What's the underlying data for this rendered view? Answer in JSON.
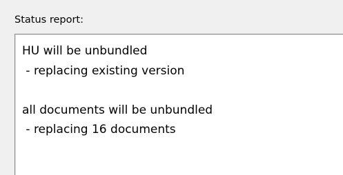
{
  "status_report": {
    "label": "Status report:",
    "lines": [
      "HU will be unbundled",
      " - replacing existing version",
      "",
      "all documents will be unbundled",
      " - replacing 16 documents"
    ]
  }
}
